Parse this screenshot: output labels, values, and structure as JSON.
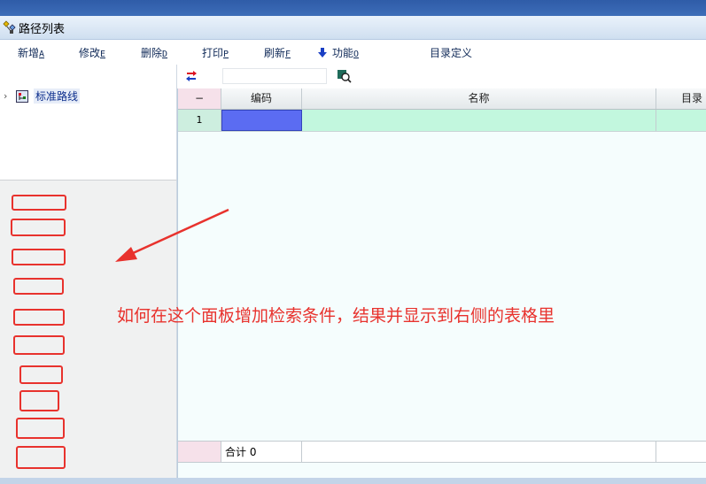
{
  "window": {
    "title": "路径列表"
  },
  "menu": [
    {
      "label": "新增",
      "key": "A"
    },
    {
      "label": "修改",
      "key": "E"
    },
    {
      "label": "删除",
      "key": "D"
    },
    {
      "label": "打印",
      "key": "P"
    },
    {
      "label": "刷新",
      "key": "F"
    },
    {
      "label": "功能",
      "key": "O",
      "icon": "arrow-down-icon"
    },
    {
      "label": "目录定义",
      "key": ""
    }
  ],
  "tree": {
    "nodes": [
      {
        "label": "标准路线",
        "icon": "folder-tree-icon",
        "selected": true
      }
    ]
  },
  "grid": {
    "search_value": "",
    "columns": [
      "−",
      "编码",
      "名称",
      "目录"
    ],
    "rows": [
      {
        "index": "1",
        "code": "",
        "name": "",
        "dir": ""
      }
    ],
    "footer": {
      "label": "合计",
      "count": "0"
    }
  },
  "annotation": {
    "text": "如何在这个面板增加检索条件，结果并显示到右侧的表格里",
    "color": "#e8322d"
  },
  "colors": {
    "title_strip": "#2f5ca8",
    "selected_cell": "#5b6cf2",
    "row_fill": "#c2f7de",
    "row_index_fill": "#cdeedf",
    "grid_background": "#f5fdfd",
    "annotation_red": "#e8322d"
  }
}
